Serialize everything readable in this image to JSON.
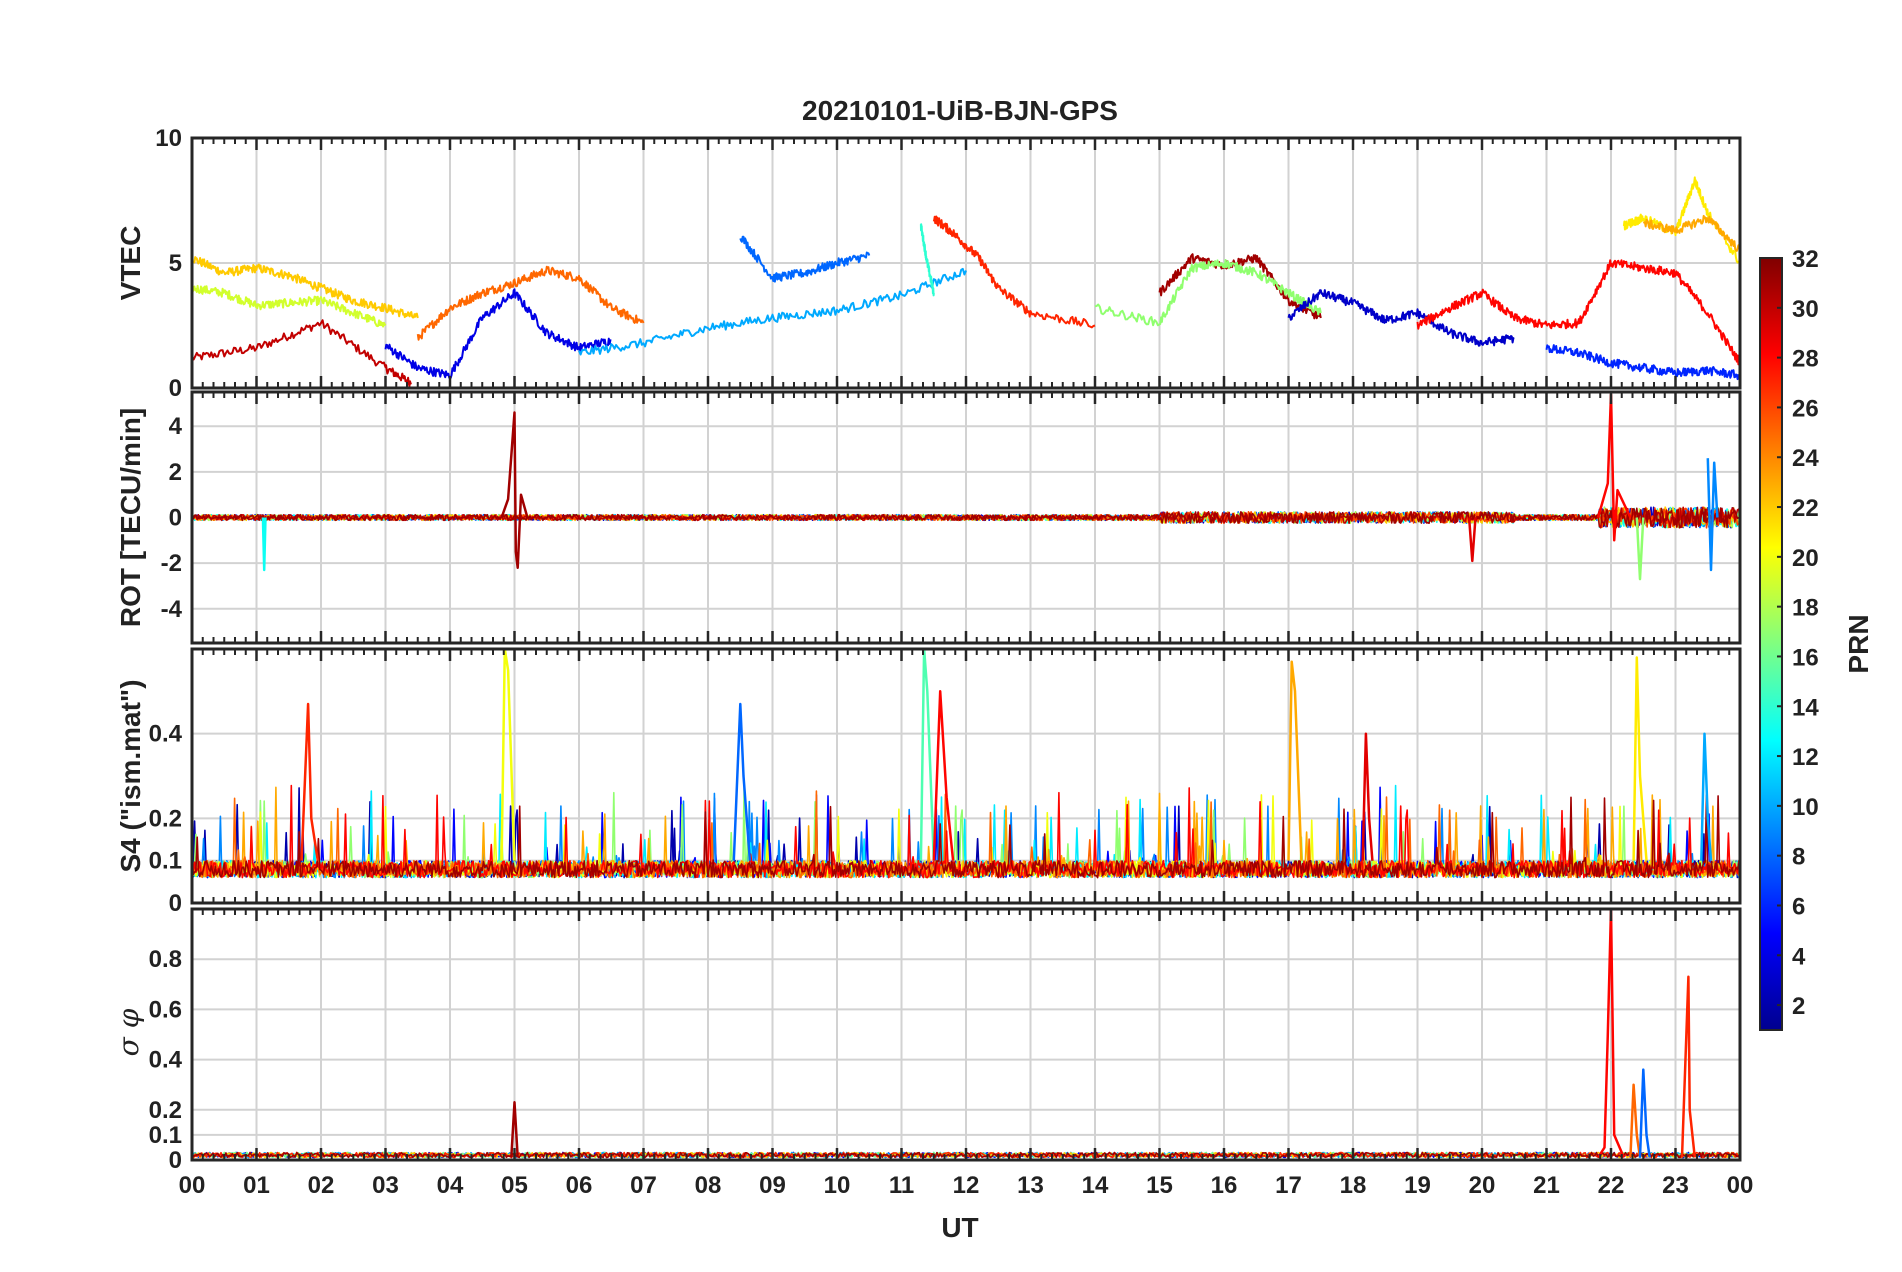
{
  "chart_data": {
    "type": "line",
    "title": "20210101-UiB-BJN-GPS",
    "xlabel": "UT",
    "x_tick_labels": [
      "00",
      "01",
      "02",
      "03",
      "04",
      "05",
      "06",
      "07",
      "08",
      "09",
      "10",
      "11",
      "12",
      "13",
      "14",
      "15",
      "16",
      "17",
      "18",
      "19",
      "20",
      "21",
      "22",
      "23",
      "00"
    ],
    "xlim": [
      0,
      24
    ],
    "grid": true,
    "colorbar": {
      "label": "PRN",
      "range": [
        1,
        32
      ],
      "tick_labels": [
        "2",
        "4",
        "6",
        "8",
        "10",
        "12",
        "14",
        "16",
        "18",
        "20",
        "22",
        "24",
        "26",
        "28",
        "30",
        "32"
      ],
      "colormap": "jet",
      "colors": [
        "#00008f",
        "#0000ff",
        "#0080ff",
        "#00ffff",
        "#80ff80",
        "#ffff00",
        "#ff8000",
        "#ff0000",
        "#800000"
      ]
    },
    "panels": [
      {
        "ylabel": "VTEC",
        "ylim": [
          0,
          10
        ],
        "y_tick_labels": [
          "0",
          "5",
          "10"
        ],
        "series": [
          {
            "prn": 30,
            "x": [
              0,
              1,
              2,
              3,
              3.4
            ],
            "y": [
              1.2,
              1.6,
              2.6,
              0.8,
              0.2
            ]
          },
          {
            "prn": 22,
            "x": [
              0,
              0.5,
              1,
              1.5,
              2,
              2.5,
              3,
              3.5
            ],
            "y": [
              5.2,
              4.6,
              4.8,
              4.5,
              4.0,
              3.5,
              3.2,
              2.8
            ]
          },
          {
            "prn": 19,
            "x": [
              0,
              0.5,
              1,
              1.5,
              2,
              2.5,
              3
            ],
            "y": [
              4.0,
              3.8,
              3.3,
              3.4,
              3.5,
              3.0,
              2.5
            ]
          },
          {
            "prn": 25,
            "x": [
              3.5,
              4,
              4.5,
              5,
              5.5,
              6,
              6.5,
              7
            ],
            "y": [
              2.0,
              3.2,
              3.8,
              4.2,
              4.7,
              4.4,
              3.2,
              2.6
            ]
          },
          {
            "prn": 4,
            "x": [
              3,
              3.5,
              4,
              4.5,
              5,
              5.5,
              6,
              6.5
            ],
            "y": [
              1.7,
              0.8,
              0.5,
              2.8,
              3.8,
              2.2,
              1.6,
              1.9
            ]
          },
          {
            "prn": 8,
            "x": [
              8.5,
              9,
              9.5,
              10,
              10.5
            ],
            "y": [
              6.1,
              4.4,
              4.6,
              5.0,
              5.3
            ]
          },
          {
            "prn": 10,
            "x": [
              6,
              7,
              8,
              9,
              10,
              11,
              12
            ],
            "y": [
              1.4,
              1.8,
              2.4,
              2.8,
              3.1,
              3.7,
              4.7
            ]
          },
          {
            "prn": 14,
            "x": [
              11.3,
              11.4,
              11.5
            ],
            "y": [
              6.5,
              5.0,
              3.8
            ]
          },
          {
            "prn": 27,
            "x": [
              11.5,
              11.8,
              12.2,
              12.5,
              13,
              14
            ],
            "y": [
              6.8,
              6.2,
              5.2,
              4.0,
              3.0,
              2.5
            ]
          },
          {
            "prn": 31,
            "x": [
              15,
              15.5,
              16,
              16.5,
              17,
              17.5
            ],
            "y": [
              3.8,
              5.2,
              4.9,
              5.2,
              3.5,
              2.8
            ]
          },
          {
            "prn": 17,
            "x": [
              14,
              15,
              15.5,
              16,
              16.5,
              17,
              17.5
            ],
            "y": [
              3.2,
              2.6,
              4.8,
              5.0,
              4.6,
              3.8,
              3.0
            ]
          },
          {
            "prn": 3,
            "x": [
              17,
              17.5,
              18,
              18.5,
              19,
              19.5,
              20,
              20.5
            ],
            "y": [
              2.8,
              3.8,
              3.4,
              2.7,
              3.0,
              2.2,
              1.8,
              2.0
            ]
          },
          {
            "prn": 28,
            "x": [
              19,
              19.5,
              20,
              20.5,
              21,
              21.5,
              22,
              22.5,
              23,
              23.5,
              24
            ],
            "y": [
              2.5,
              3.2,
              3.8,
              2.8,
              2.5,
              2.6,
              5.0,
              4.8,
              4.6,
              3.0,
              1.0
            ]
          },
          {
            "prn": 21,
            "x": [
              22.2,
              22.5,
              23,
              23.3,
              23.5,
              24
            ],
            "y": [
              6.5,
              6.8,
              6.2,
              8.3,
              7.0,
              5.0
            ]
          },
          {
            "prn": 23,
            "x": [
              22.5,
              23,
              23.5,
              24
            ],
            "y": [
              6.6,
              6.3,
              6.8,
              5.5
            ]
          },
          {
            "prn": 6,
            "x": [
              21,
              21.5,
              22,
              22.5,
              23,
              23.5,
              24
            ],
            "y": [
              1.6,
              1.4,
              1.0,
              0.8,
              0.6,
              0.7,
              0.5
            ]
          }
        ]
      },
      {
        "ylabel": "ROT [TECU/min]",
        "ylim": [
          -5.5,
          5.5
        ],
        "y_tick_labels": [
          "-4",
          "-2",
          "0",
          "2",
          "4"
        ],
        "series": [
          {
            "prn": 31,
            "x": [
              4.8,
              4.9,
              5.0,
              5.02,
              5.05,
              5.1,
              5.2
            ],
            "y": [
              0,
              0.8,
              4.6,
              -1.5,
              -2.2,
              1.0,
              0
            ]
          },
          {
            "prn": 28,
            "x": [
              21.8,
              21.95,
              22.0,
              22.05,
              22.1,
              22.3
            ],
            "y": [
              0,
              1.5,
              5.4,
              -1.0,
              1.2,
              0
            ]
          },
          {
            "prn": 13,
            "x": [
              1.1,
              1.12,
              1.14
            ],
            "y": [
              0,
              -2.3,
              0
            ]
          },
          {
            "prn": 9,
            "x": [
              23.5,
              23.55,
              23.6,
              23.65
            ],
            "y": [
              2.6,
              -2.3,
              2.4,
              0
            ]
          },
          {
            "prn": 29,
            "x": [
              19.8,
              19.85,
              19.9
            ],
            "y": [
              0,
              -1.9,
              0
            ]
          },
          {
            "prn": 17,
            "x": [
              22.4,
              22.45,
              22.5
            ],
            "y": [
              0,
              -2.7,
              0
            ]
          }
        ]
      },
      {
        "ylabel": "S4 (\"ism.mat\")",
        "ylim": [
          0,
          0.6
        ],
        "y_tick_labels": [
          "0",
          "0.1",
          "0.2",
          "0.4"
        ],
        "series": [
          {
            "prn": 20,
            "x": [
              4.8,
              4.85,
              4.9,
              5.0
            ],
            "y": [
              0.1,
              0.6,
              0.55,
              0.1
            ]
          },
          {
            "prn": 15,
            "x": [
              11.3,
              11.35,
              11.4,
              11.5
            ],
            "y": [
              0.1,
              0.6,
              0.5,
              0.1
            ]
          },
          {
            "prn": 23,
            "x": [
              17,
              17.05,
              17.1,
              17.2
            ],
            "y": [
              0.1,
              0.57,
              0.5,
              0.1
            ]
          },
          {
            "prn": 21,
            "x": [
              22.35,
              22.4,
              22.45,
              22.55
            ],
            "y": [
              0.1,
              0.58,
              0.3,
              0.1
            ]
          },
          {
            "prn": 27,
            "x": [
              1.7,
              1.8,
              1.85,
              1.95
            ],
            "y": [
              0.1,
              0.47,
              0.2,
              0.1
            ]
          },
          {
            "prn": 8,
            "x": [
              8.4,
              8.5,
              8.55,
              8.65
            ],
            "y": [
              0.1,
              0.47,
              0.3,
              0.1
            ]
          },
          {
            "prn": 28,
            "x": [
              11.5,
              11.6,
              11.7,
              11.8
            ],
            "y": [
              0.1,
              0.5,
              0.25,
              0.1
            ]
          },
          {
            "prn": 29,
            "x": [
              18.15,
              18.2,
              18.25,
              18.3
            ],
            "y": [
              0.1,
              0.4,
              0.2,
              0.1
            ]
          },
          {
            "prn": 10,
            "x": [
              23.4,
              23.45,
              23.5,
              23.55
            ],
            "y": [
              0.1,
              0.4,
              0.2,
              0.1
            ]
          }
        ]
      },
      {
        "ylabel": "σ φ",
        "ylim": [
          0,
          1
        ],
        "y_tick_labels": [
          "0",
          "0.1",
          "0.2",
          "0.4",
          "0.6",
          "0.8"
        ],
        "series": [
          {
            "prn": 28,
            "x": [
              21.8,
              21.9,
              21.95,
              22.0,
              22.05,
              22.2
            ],
            "y": [
              0.01,
              0.05,
              0.5,
              1.0,
              0.1,
              0.01
            ]
          },
          {
            "prn": 27,
            "x": [
              23.1,
              23.2,
              23.22,
              23.3
            ],
            "y": [
              0.01,
              0.73,
              0.2,
              0.01
            ]
          },
          {
            "prn": 25,
            "x": [
              22.3,
              22.35,
              22.4,
              22.45
            ],
            "y": [
              0.01,
              0.3,
              0.1,
              0.01
            ]
          },
          {
            "prn": 8,
            "x": [
              22.45,
              22.5,
              22.55,
              22.6
            ],
            "y": [
              0.01,
              0.36,
              0.1,
              0.01
            ]
          },
          {
            "prn": 31,
            "x": [
              4.95,
              5.0,
              5.05
            ],
            "y": [
              0.01,
              0.23,
              0.01
            ]
          }
        ]
      }
    ]
  }
}
